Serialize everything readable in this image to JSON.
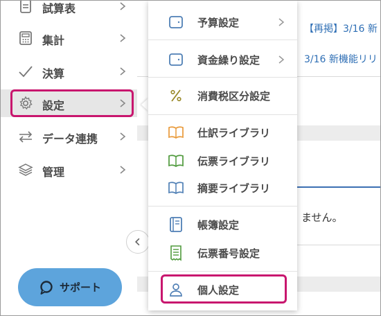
{
  "sidebar": {
    "items": [
      {
        "label": "試算表",
        "icon": "document-icon"
      },
      {
        "label": "集計",
        "icon": "calculator-icon"
      },
      {
        "label": "決算",
        "icon": "check-icon"
      },
      {
        "label": "設定",
        "icon": "gear-icon"
      },
      {
        "label": "データ連携",
        "icon": "swap-arrows-icon"
      },
      {
        "label": "管理",
        "icon": "layers-icon"
      }
    ],
    "active_item": "設定",
    "support_label": "サポート"
  },
  "settings_menu": {
    "items": [
      {
        "label": "予算設定",
        "icon": "wallet-icon",
        "has_submenu": true
      },
      {
        "label": "資金繰り設定",
        "icon": "wallet-icon",
        "has_submenu": true
      },
      {
        "label": "消費税区分設定",
        "icon": "percent-icon",
        "has_submenu": false
      },
      {
        "label": "仕訳ライブラリ",
        "icon": "book-icon",
        "has_submenu": false
      },
      {
        "label": "伝票ライブラリ",
        "icon": "book-icon",
        "has_submenu": false
      },
      {
        "label": "摘要ライブラリ",
        "icon": "book-icon",
        "has_submenu": false
      },
      {
        "label": "帳簿設定",
        "icon": "ledger-icon",
        "has_submenu": false
      },
      {
        "label": "伝票番号設定",
        "icon": "receipt-icon",
        "has_submenu": false
      },
      {
        "label": "個人設定",
        "icon": "person-icon",
        "has_submenu": false
      }
    ],
    "highlighted_item": "個人設定"
  },
  "background": {
    "news": [
      "【再掲】3/16 新",
      "3/16 新機能リリ"
    ],
    "message": "ません。"
  },
  "colors": {
    "highlight": "#c8166e",
    "support_button": "#5da4dc",
    "link": "#2f6fb5",
    "icon_blue": "#4f7fb5",
    "icon_orange": "#e99a3a",
    "icon_green": "#4f9a3c",
    "icon_olive": "#9a8a2a"
  }
}
